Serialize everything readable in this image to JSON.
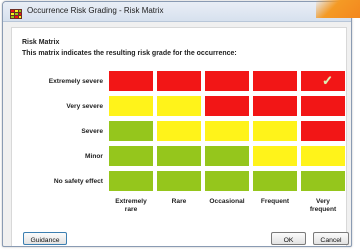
{
  "window": {
    "title": "Occurrence Risk Grading - Risk Matrix"
  },
  "matrix": {
    "heading": "Risk Matrix",
    "description": "This matrix indicates the resulting risk grade for the occurrence:",
    "rows": [
      {
        "label": "Extremely severe",
        "cells": [
          "red",
          "red",
          "red",
          "red",
          "red"
        ],
        "selected_column": 4
      },
      {
        "label": "Very severe",
        "cells": [
          "yellow",
          "yellow",
          "red",
          "red",
          "red"
        ]
      },
      {
        "label": "Severe",
        "cells": [
          "green",
          "yellow",
          "yellow",
          "yellow",
          "red"
        ]
      },
      {
        "label": "Minor",
        "cells": [
          "green",
          "green",
          "green",
          "yellow",
          "yellow"
        ]
      },
      {
        "label": "No safety effect",
        "cells": [
          "green",
          "green",
          "green",
          "green",
          "green"
        ]
      }
    ],
    "columns": [
      "Extremely\nrare",
      "Rare",
      "Occasional",
      "Frequent",
      "Very\nfrequent"
    ]
  },
  "buttons": {
    "guidance": "Guidance",
    "ok": "OK",
    "cancel": "Cancel"
  },
  "icons": {
    "window_icon": "grid-window-icon",
    "selected_mark": "checkmark-icon"
  },
  "colors": {
    "red": "#f21616",
    "yellow": "#fff31a",
    "green": "#95c61c",
    "accent": "#f3871e"
  }
}
